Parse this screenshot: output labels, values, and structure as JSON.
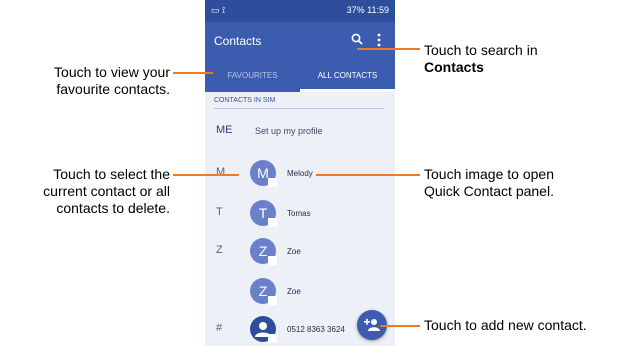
{
  "status_bar": {
    "left_icons": "▭  ⟟",
    "right_text": "37%  11:59"
  },
  "app_bar": {
    "title": "Contacts",
    "search_icon": "search-icon",
    "more_icon": "more-vert-icon"
  },
  "tabs": [
    {
      "label": "FAVOURITES",
      "selected": false
    },
    {
      "label": "ALL CONTACTS",
      "selected": true
    }
  ],
  "section_header": "CONTACTS IN SIM",
  "profile": {
    "letter": "ME",
    "text": "Set up my profile"
  },
  "contacts": [
    {
      "letter": "M",
      "initial": "M",
      "name": "Melody"
    },
    {
      "letter": "T",
      "initial": "T",
      "name": "Tomas"
    },
    {
      "letter": "Z",
      "initial": "Z",
      "name": "Zoe"
    },
    {
      "letter": "",
      "initial": "Z",
      "name": "Zoe"
    },
    {
      "letter": "#",
      "initial": "",
      "name": "0512 8363 3624"
    }
  ],
  "callouts": {
    "favourites": [
      "Touch to view your",
      "favourite contacts."
    ],
    "search_prefix": "Touch to search in",
    "search_bold": "Contacts",
    "select": [
      "Touch to select the",
      "current contact or all",
      "contacts to delete."
    ],
    "quick_contact": [
      "Touch image to open",
      "Quick Contact panel."
    ],
    "add": "Touch to add new contact."
  },
  "colors": {
    "primary": "#3c5cb0",
    "status_bar": "#2e4d9a",
    "callout_line": "#f07a22",
    "list_bg": "#eef0f8"
  }
}
